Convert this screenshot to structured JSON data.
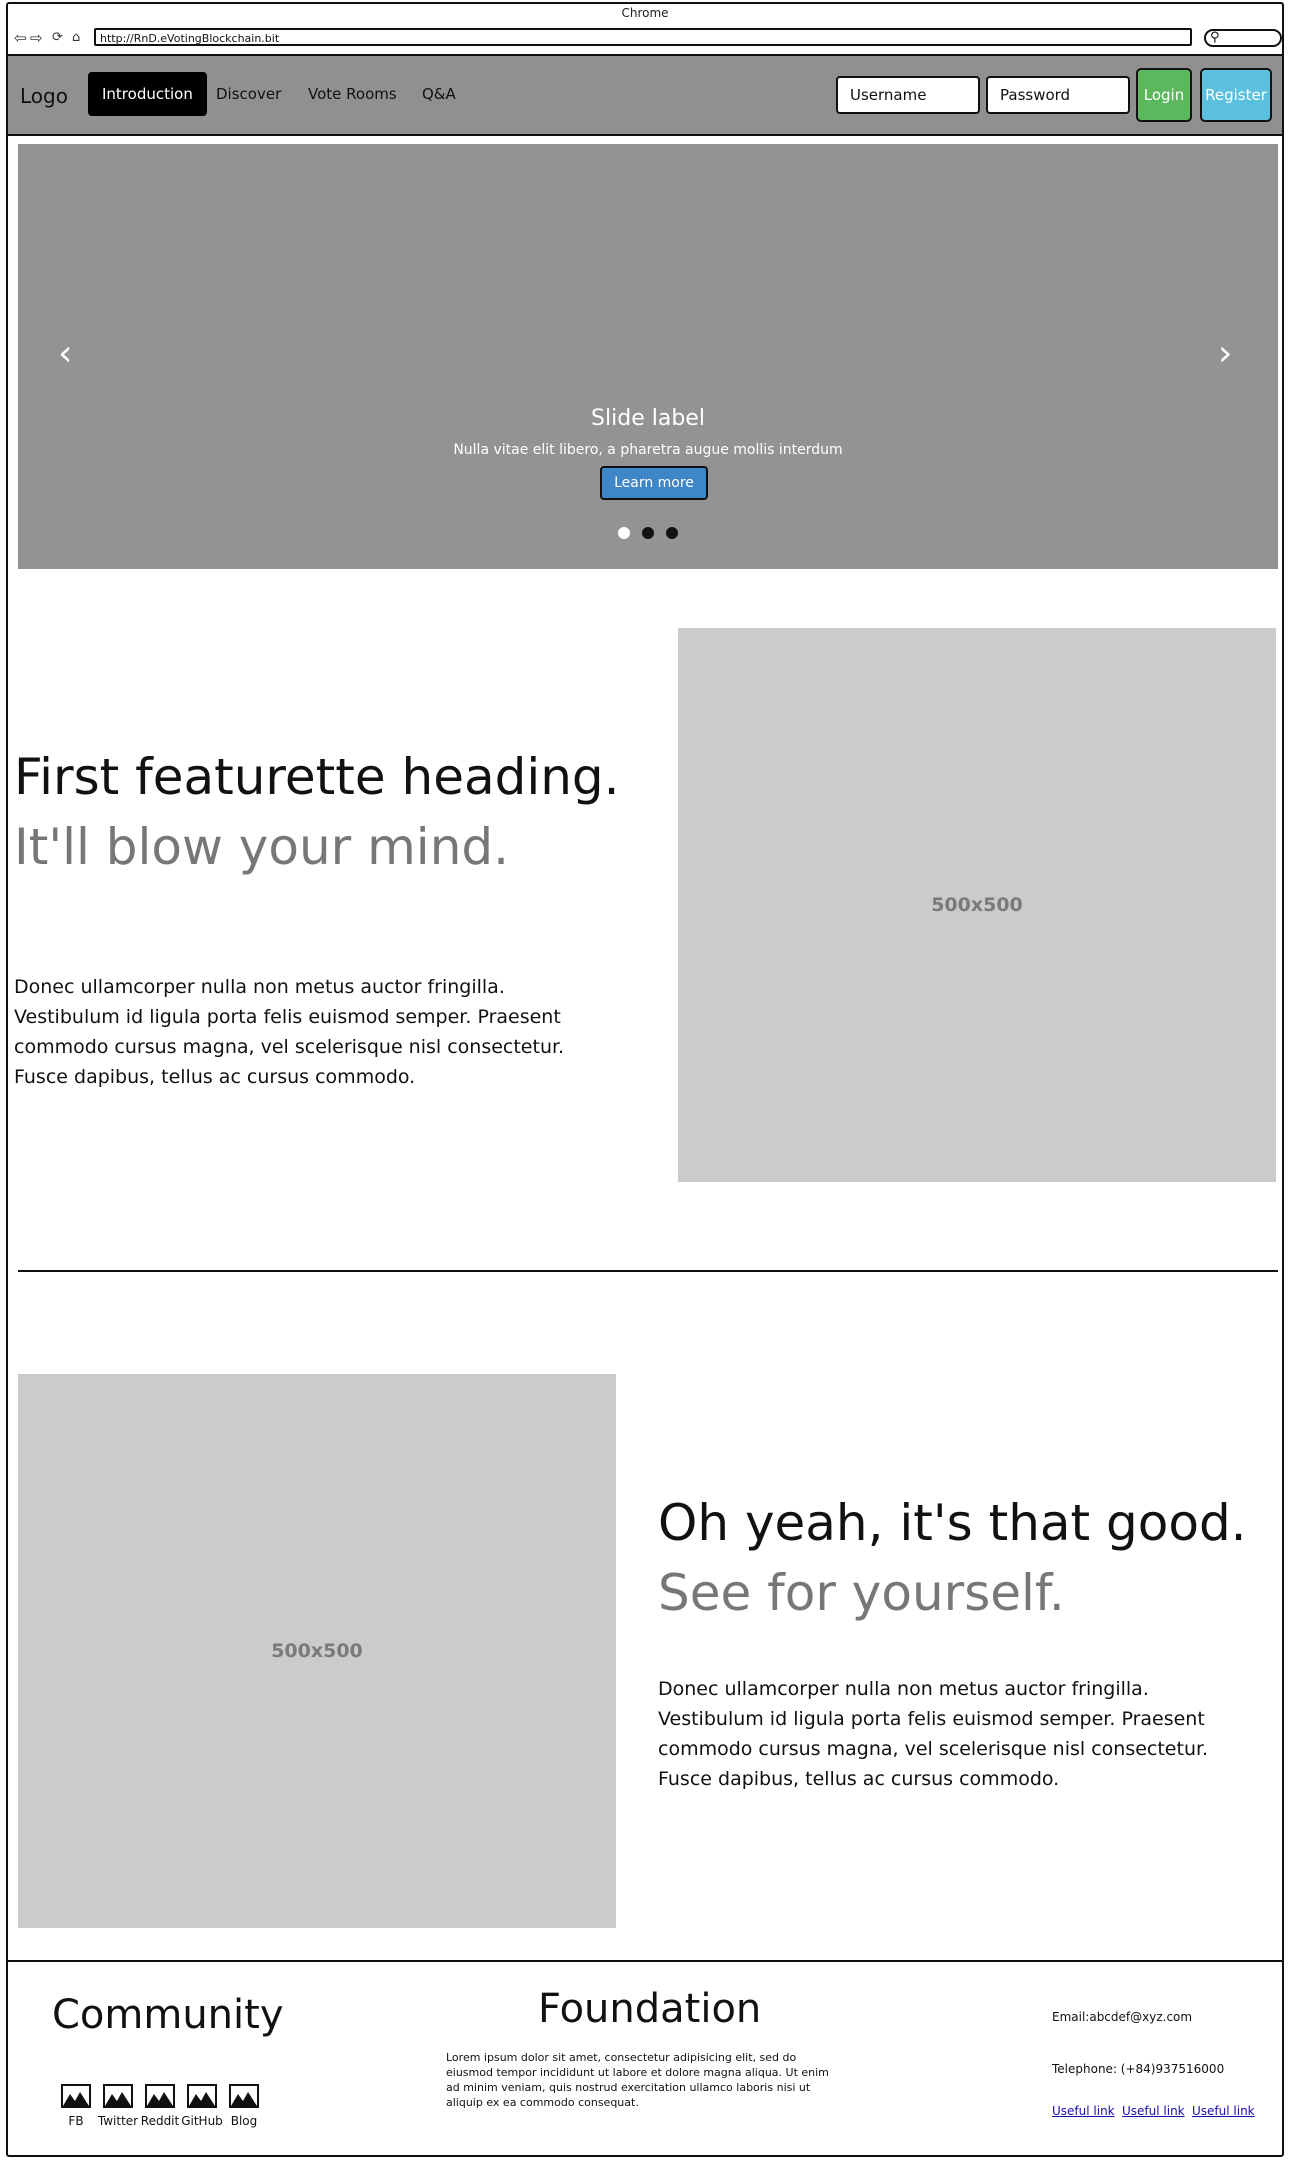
{
  "browser": {
    "title": "Chrome",
    "url": "http://RnD.eVotingBlockchain.bit",
    "icons": [
      "back-icon",
      "forward-icon",
      "reload-icon",
      "home-icon",
      "search-icon"
    ]
  },
  "navbar": {
    "logo": "Logo",
    "links": [
      "Introduction",
      "Discover",
      "Vote Rooms",
      "Q&A"
    ],
    "active_link": "Introduction",
    "username_placeholder": "Username",
    "password_placeholder": "Password",
    "login_label": "Login",
    "register_label": "Register",
    "login_color": "#5cb85c",
    "register_color": "#5bc0de"
  },
  "carousel": {
    "prev": "‹",
    "next": "›",
    "slide_label": "Slide label",
    "slide_text": "Nulla vitae elit libero, a pharetra augue mollis interdum",
    "button_label": "Learn more",
    "indicator_count": 3,
    "active_indicator": 1
  },
  "featurette1": {
    "heading": "First featurette heading.",
    "heading_muted": "It'll blow your mind.",
    "body": "Donec ullamcorper nulla non metus auctor fringilla. Vestibulum id ligula porta felis euismod semper. Praesent commodo cursus magna, vel scelerisque nisl consectetur. Fusce dapibus, tellus ac cursus commodo.",
    "image_label": "500x500"
  },
  "featurette2": {
    "heading": "Oh yeah, it's that good.",
    "heading_muted": "See for yourself.",
    "body": "Donec ullamcorper nulla non metus auctor fringilla. Vestibulum id ligula porta felis euismod semper. Praesent commodo cursus magna, vel scelerisque nisl consectetur. Fusce dapibus, tellus ac cursus commodo.",
    "image_label": "500x500"
  },
  "footer": {
    "community_title": "Community",
    "social": [
      "FB",
      "Twitter",
      "Reddit",
      "GitHub",
      "Blog"
    ],
    "foundation_title": "Foundation",
    "foundation_text": "Lorem ipsum dolor sit amet, consectetur adipisicing elit, sed do eiusmod tempor incididunt ut labore et dolore magna aliqua. Ut enim ad minim veniam, quis nostrud exercitation ullamco laboris nisi ut aliquip ex ea commodo consequat.",
    "email": "Email:abcdef@xyz.com",
    "telephone": "Telephone: (+84)937516000",
    "links": [
      "Useful link",
      "Useful link",
      "Useful link"
    ]
  }
}
